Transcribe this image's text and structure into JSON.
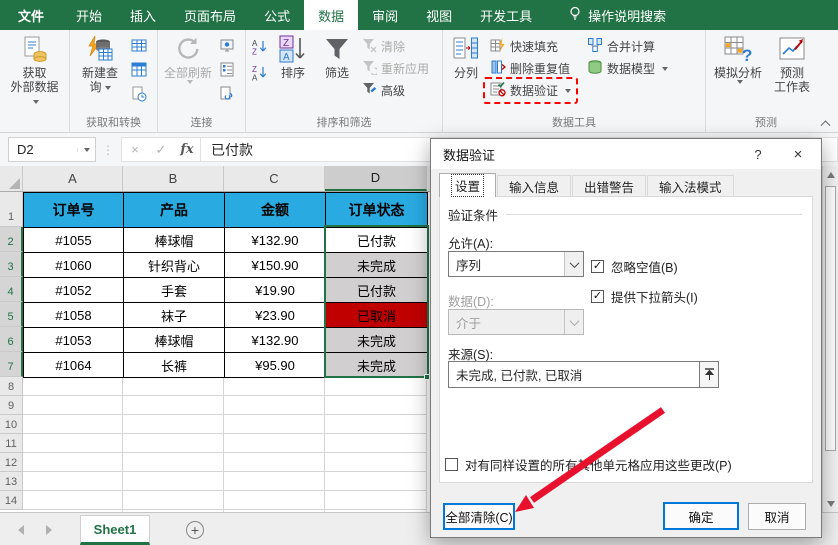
{
  "titlebar": {
    "tabs": [
      "文件",
      "开始",
      "插入",
      "页面布局",
      "公式",
      "数据",
      "审阅",
      "视图",
      "开发工具"
    ],
    "search": "操作说明搜索"
  },
  "ribbon": {
    "get_external": "获取\n外部数据",
    "new_query": "新建查\n询",
    "refresh_all": "全部刷新",
    "sort": "排序",
    "filter": "筛选",
    "clear": "清除",
    "reapply": "重新应用",
    "advanced": "高级",
    "text_to_columns": "分列",
    "flash_fill": "快速填充",
    "remove_duplicates": "删除重复值",
    "data_validation": "数据验证",
    "consolidate": "合并计算",
    "data_model": "数据模型",
    "what_if": "模拟分析",
    "forecast_sheet": "预测\n工作表",
    "groups": {
      "get_transform": "获取和转换",
      "connections": "连接",
      "sort_filter": "排序和筛选",
      "data_tools": "数据工具",
      "forecast": "预测"
    }
  },
  "formula_bar": {
    "name_box": "D2",
    "value": "已付款"
  },
  "icons": {
    "cancel": "×",
    "confirm": "✓",
    "fx": "fx",
    "add_sheet": "+",
    "help": "?",
    "close": "×"
  },
  "sheet": {
    "columns": [
      "A",
      "B",
      "C",
      "D"
    ],
    "row_numbers": [
      "1",
      "2",
      "3",
      "4",
      "5",
      "6",
      "7",
      "8",
      "9",
      "10",
      "11",
      "12",
      "13",
      "14"
    ],
    "table": {
      "headers": [
        "订单号",
        "产品",
        "金额",
        "订单状态"
      ],
      "rows": [
        [
          "#1055",
          "棒球帽",
          "¥132.90",
          "已付款"
        ],
        [
          "#1060",
          "针织背心",
          "¥150.90",
          "未完成"
        ],
        [
          "#1052",
          "手套",
          "¥19.90",
          "已付款"
        ],
        [
          "#1058",
          "袜子",
          "¥23.90",
          "已取消"
        ],
        [
          "#1053",
          "棒球帽",
          "¥132.90",
          "未完成"
        ],
        [
          "#1064",
          "长裤",
          "¥95.90",
          "未完成"
        ]
      ]
    },
    "tab": "Sheet1"
  },
  "dialog": {
    "title": "数据验证",
    "tabs": [
      "设置",
      "输入信息",
      "出错警告",
      "输入法模式"
    ],
    "section": "验证条件",
    "allow_label": "允许(A):",
    "allow_value": "序列",
    "ignore_blank": "忽略空值(B)",
    "in_cell_dropdown": "提供下拉箭头(I)",
    "data_label": "数据(D):",
    "data_value": "介于",
    "source_label": "来源(S):",
    "source_value": "未完成, 已付款, 已取消",
    "apply_all": "对有同样设置的所有其他单元格应用这些更改(P)",
    "clear_all": "全部清除(C)",
    "ok": "确定",
    "cancel": "取消"
  },
  "colors": {
    "excel_green": "#217346",
    "table_header_blue": "#29ABE2",
    "cancelled_cell_red": "#C00000",
    "selection_gray": "#D1CFD0",
    "focus_blue": "#0078D7",
    "highlight_dashed_red": "#FF0000",
    "annotation_arrow_red": "#E8112D"
  }
}
